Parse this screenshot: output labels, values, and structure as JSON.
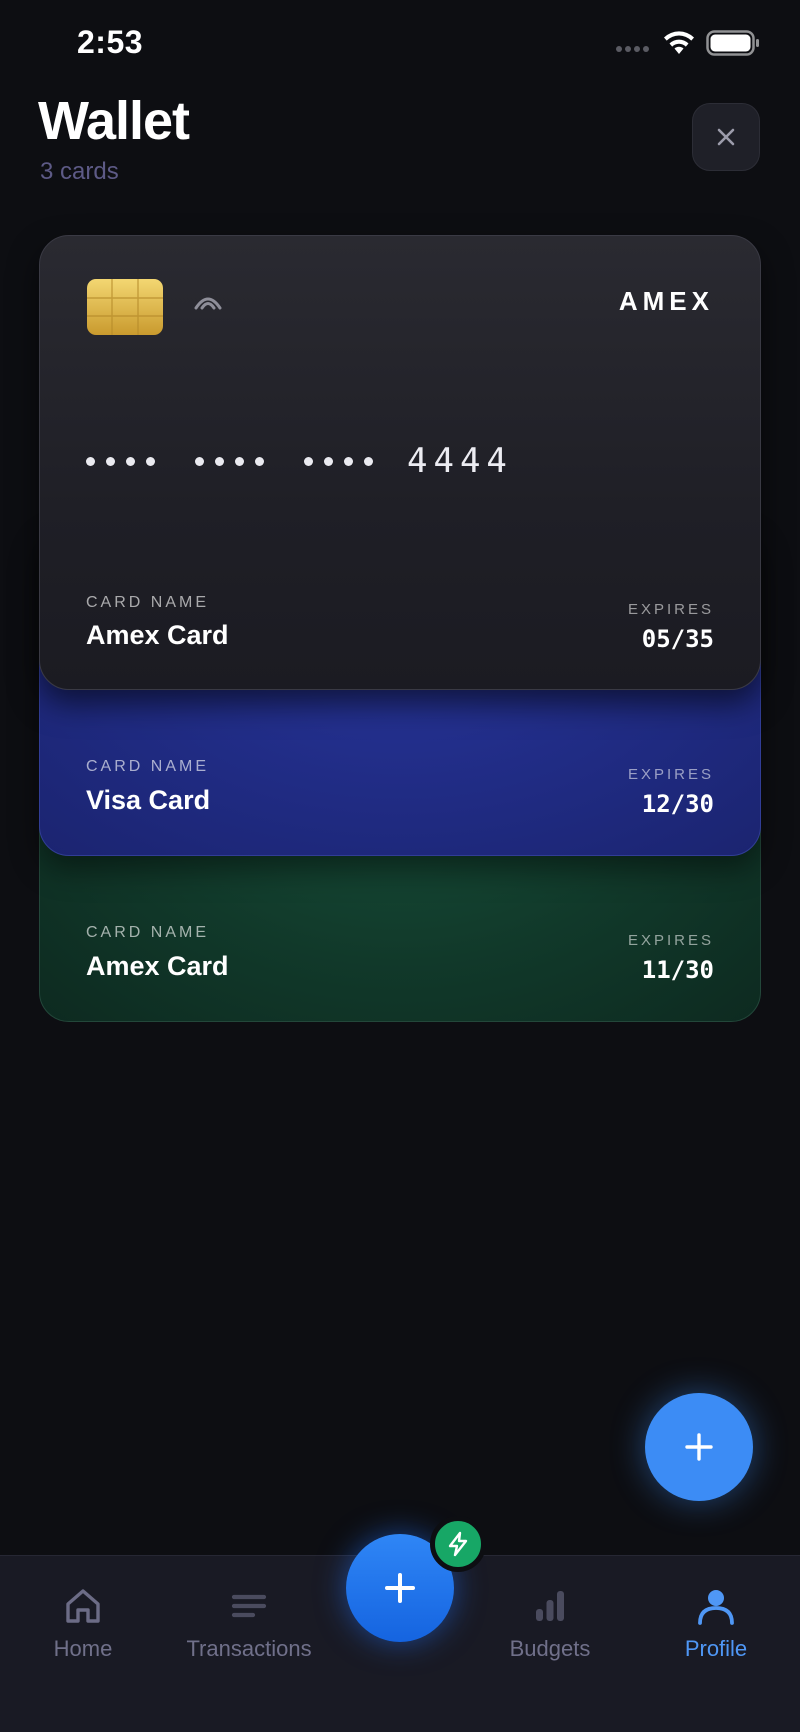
{
  "status_bar": {
    "time": "2:53"
  },
  "header": {
    "title": "Wallet",
    "subtitle": "3 cards",
    "close_label": "×"
  },
  "cards": [
    {
      "brand": "AMEX",
      "last4": "4444",
      "name_label": "CARD NAME",
      "name": "Amex Card",
      "expires_label": "EXPIRES",
      "expires": "05/35"
    },
    {
      "name_label": "CARD NAME",
      "name": "Visa Card",
      "expires_label": "EXPIRES",
      "expires": "12/30"
    },
    {
      "name_label": "CARD NAME",
      "name": "Amex Card",
      "expires_label": "EXPIRES",
      "expires": "11/30"
    }
  ],
  "fab": {
    "label": "+"
  },
  "nav": {
    "items": [
      {
        "label": "Home",
        "icon": "home-icon"
      },
      {
        "label": "Transactions",
        "icon": "list-icon"
      },
      {
        "label": "Budgets",
        "icon": "bar-chart-icon"
      },
      {
        "label": "Profile",
        "icon": "user-icon",
        "active": true
      }
    ],
    "center_label": "+"
  },
  "colors": {
    "accent": "#3c8cf5",
    "active_nav": "#4f97f5",
    "quick_action": "#17a766",
    "background": "#0d0e12"
  }
}
